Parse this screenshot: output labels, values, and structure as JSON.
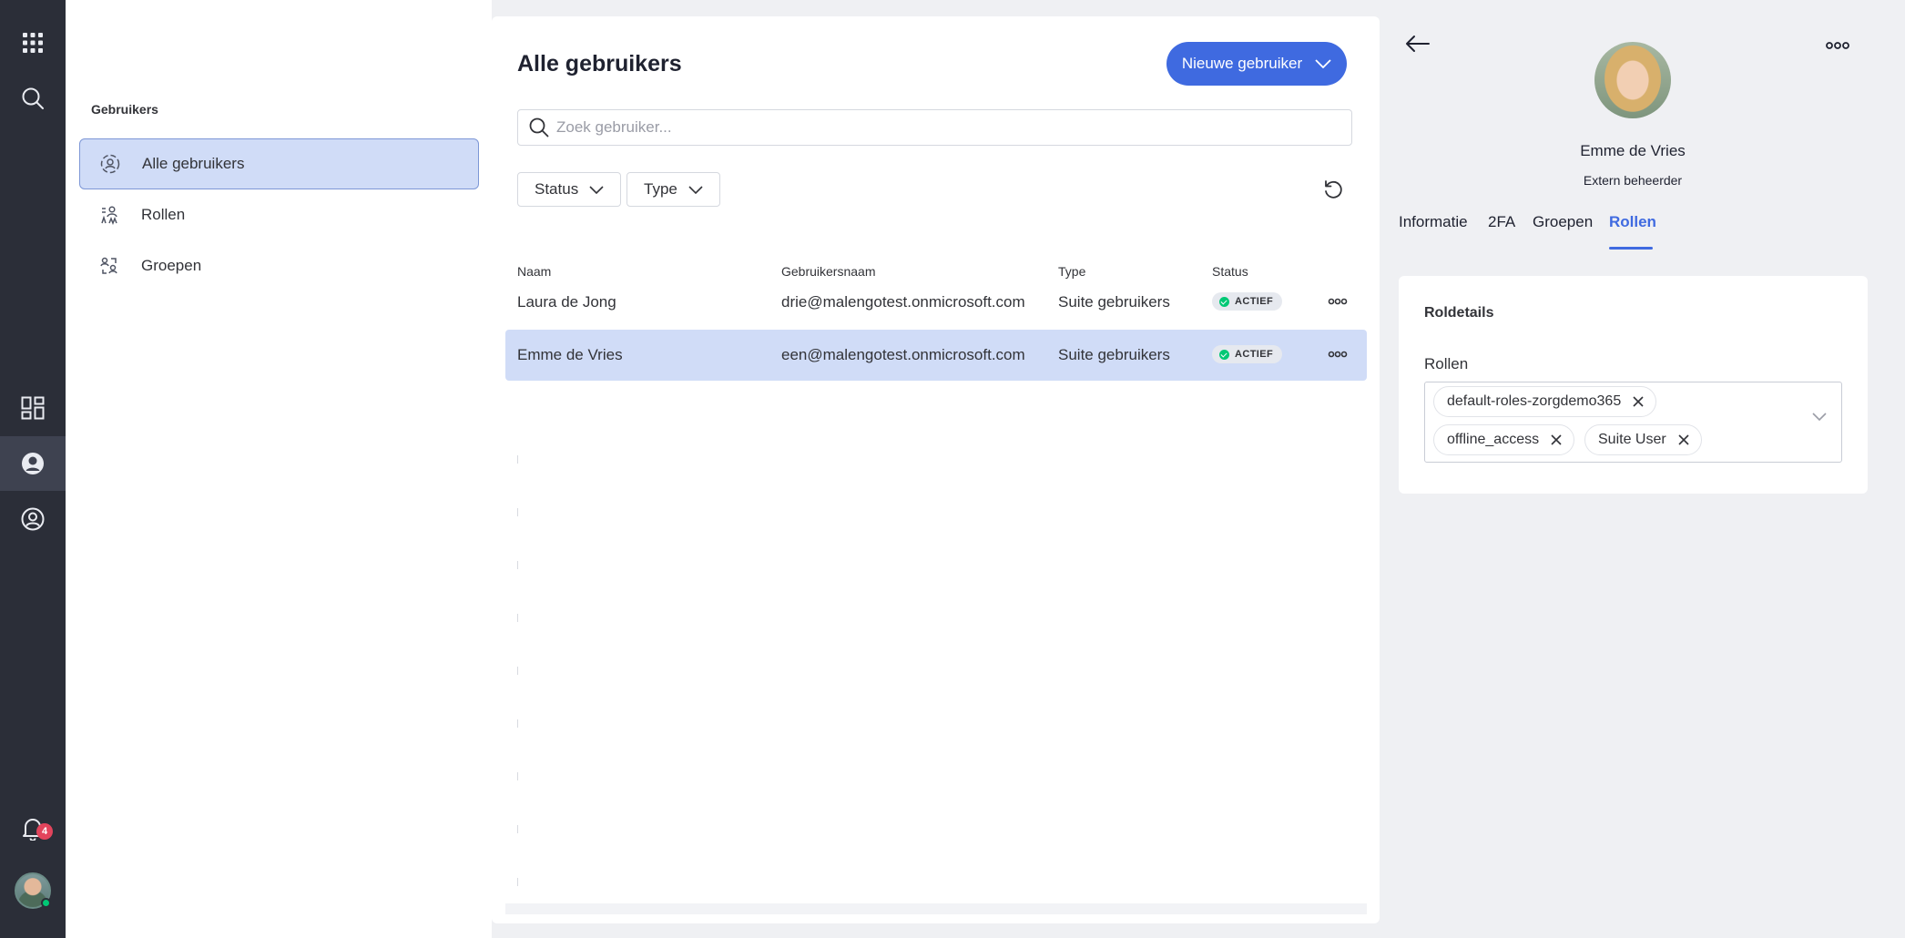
{
  "rail": {
    "notifications_count": "4"
  },
  "subnav": {
    "title": "Gebruikers",
    "items": [
      {
        "label": "Alle gebruikers",
        "icon": "users-icon",
        "active": true
      },
      {
        "label": "Rollen",
        "icon": "roles-icon",
        "active": false
      },
      {
        "label": "Groepen",
        "icon": "groups-icon",
        "active": false
      }
    ]
  },
  "main": {
    "title": "Alle gebruikers",
    "new_user_label": "Nieuwe gebruiker",
    "search_placeholder": "Zoek gebruiker...",
    "filters": {
      "status": "Status",
      "type": "Type"
    },
    "columns": {
      "name": "Naam",
      "username": "Gebruikersnaam",
      "type": "Type",
      "status": "Status"
    },
    "rows": [
      {
        "name": "Laura de Jong",
        "username": "drie@malengotest.onmicrosoft.com",
        "type": "Suite gebruikers",
        "status": "ACTIEF",
        "selected": false
      },
      {
        "name": "Emme de Vries",
        "username": "een@malengotest.onmicrosoft.com",
        "type": "Suite gebruikers",
        "status": "ACTIEF",
        "selected": true
      }
    ]
  },
  "detail": {
    "name": "Emme de Vries",
    "role": "Extern beheerder",
    "tabs": [
      "Informatie",
      "2FA",
      "Groepen",
      "Rollen"
    ],
    "active_tab": "Rollen",
    "card": {
      "title": "Roldetails",
      "label": "Rollen",
      "chips": [
        "default-roles-zorgdemo365",
        "offline_access",
        "Suite User"
      ]
    }
  },
  "colors": {
    "accent": "#3f6ae0",
    "rail_bg": "#2b2e38",
    "selected_row": "#d0dcf7",
    "status_ok": "#00c875",
    "badge": "#e2445c"
  }
}
